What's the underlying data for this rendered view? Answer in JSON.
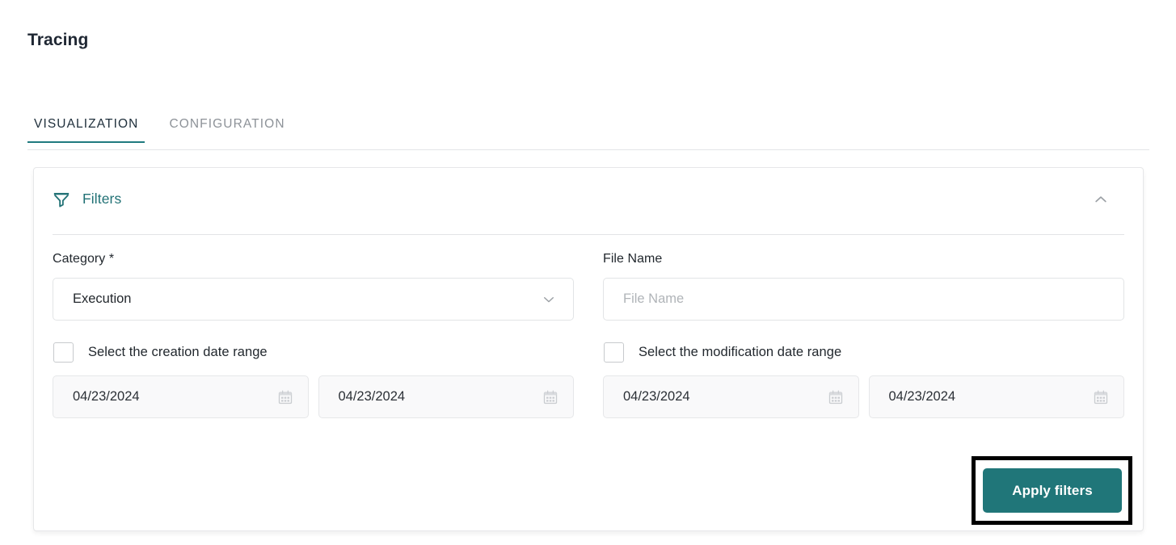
{
  "page": {
    "title": "Tracing"
  },
  "tabs": [
    {
      "label": "VISUALIZATION",
      "active": true
    },
    {
      "label": "CONFIGURATION",
      "active": false
    }
  ],
  "filters_card": {
    "title": "Filters",
    "icon": "funnel-icon",
    "collapse_icon": "chevron-up-icon",
    "accent_color": "#217175",
    "category": {
      "label": "Category *",
      "value": "Execution",
      "chevron_icon": "chevron-down-icon"
    },
    "file_name": {
      "label": "File Name",
      "value": "",
      "placeholder": "File Name"
    },
    "creation_date": {
      "checkbox_label": "Select the creation date range",
      "checked": false,
      "from": "04/23/2024",
      "to": "04/23/2024",
      "calendar_icon": "calendar-icon"
    },
    "modification_date": {
      "checkbox_label": "Select the modification date range",
      "checked": false,
      "from": "04/23/2024",
      "to": "04/23/2024",
      "calendar_icon": "calendar-icon"
    },
    "apply_button": {
      "label": "Apply filters",
      "color": "#207679",
      "highlighted": true
    }
  }
}
